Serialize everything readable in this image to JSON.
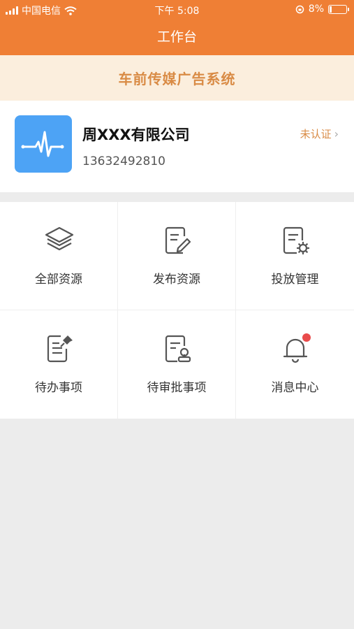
{
  "status_bar": {
    "carrier": "中国电信",
    "time": "下午 5:08",
    "battery": "8%"
  },
  "header": {
    "title": "工作台"
  },
  "banner": {
    "text": "车前传媒广告系统"
  },
  "company": {
    "name": "周XXX有限公司",
    "phone": "13632492810",
    "status": "未认证"
  },
  "menu": [
    {
      "label": "全部资源",
      "icon": "layers-icon"
    },
    {
      "label": "发布资源",
      "icon": "edit-document-icon"
    },
    {
      "label": "投放管理",
      "icon": "document-settings-icon"
    },
    {
      "label": "待办事项",
      "icon": "pinned-note-icon"
    },
    {
      "label": "待审批事项",
      "icon": "approval-document-icon"
    },
    {
      "label": "消息中心",
      "icon": "bell-icon"
    }
  ],
  "colors": {
    "header": "#ef7f35",
    "banner_bg": "#fbeedd",
    "banner_text": "#d98b45",
    "logo_bg": "#4da3f5",
    "notification_dot": "#e94b4b"
  }
}
